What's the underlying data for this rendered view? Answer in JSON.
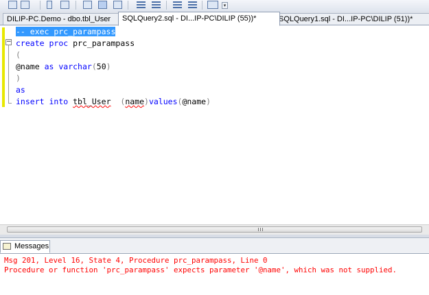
{
  "toolbar": {
    "icons": [
      "object-explorer-icon",
      "properties-icon",
      "query-options-icon",
      "results-to-icon",
      "results-grid-icon",
      "results-file-icon",
      "comment-icon",
      "uncomment-icon",
      "indent-icon",
      "outdent-icon",
      "specify-values-icon"
    ],
    "dropdown_glyph": "▾"
  },
  "tabs": [
    {
      "label": "DILIP-PC.Demo - dbo.tbl_User",
      "active": false
    },
    {
      "label": "SQLQuery2.sql - DI...IP-PC\\DILIP (55))*",
      "active": true
    },
    {
      "label": "SQLQuery1.sql - DI...IP-PC\\DILIP (51))*",
      "active": false
    }
  ],
  "editor": {
    "line1": {
      "comment": "-- exec prc_parampass"
    },
    "line2": {
      "kw1": "create",
      "kw2": "proc",
      "name": "prc_parampass"
    },
    "line3": {
      "paren": "("
    },
    "line4": {
      "param": "@name",
      "as": "as",
      "type": "varchar",
      "open": "(",
      "size": "50",
      "close": ")"
    },
    "line5": {
      "paren": ")"
    },
    "line6": {
      "kw": "as"
    },
    "line7": {
      "insert": "insert",
      "into": "into",
      "table": "tbl_User",
      "open": "(",
      "col": "name",
      "close": ")",
      "values": "values",
      "vopen": "(",
      "param": "@name",
      "vclose": ")"
    }
  },
  "results": {
    "tab_label": "Messages",
    "messages": [
      "Msg 201, Level 16, State 4, Procedure prc_parampass, Line 0",
      "Procedure or function 'prc_parampass' expects parameter '@name', which was not supplied."
    ]
  },
  "colors": {
    "keyword": "#0000ff",
    "comment": "#008000",
    "gray": "#808080",
    "error": "#ff0000",
    "selection": "#3399ff"
  }
}
